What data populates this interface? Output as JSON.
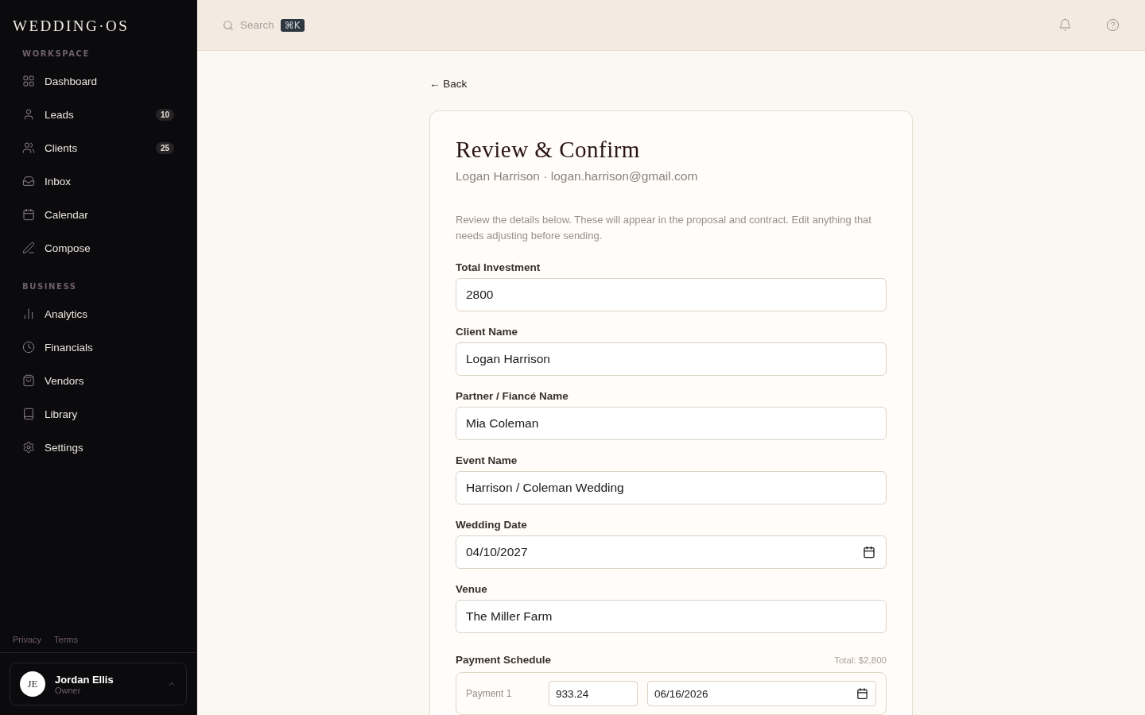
{
  "sidebar": {
    "logo": "WEDDING·OS",
    "sections": [
      {
        "title": "WORKSPACE",
        "items": [
          {
            "label": "Dashboard",
            "selected": false
          },
          {
            "label": "Leads",
            "badge": "10",
            "selected": false
          },
          {
            "label": "Clients",
            "badge": "25",
            "selected": false
          },
          {
            "label": "Inbox",
            "selected": false
          },
          {
            "label": "Calendar",
            "selected": false
          },
          {
            "label": "Compose",
            "selected": false
          }
        ]
      },
      {
        "title": "BUSINESS",
        "items": [
          {
            "label": "Analytics",
            "selected": false
          },
          {
            "label": "Financials",
            "selected": false
          },
          {
            "label": "Vendors",
            "selected": false
          },
          {
            "label": "Library",
            "selected": false
          },
          {
            "label": "Settings",
            "selected": false
          }
        ]
      }
    ],
    "footer_links": [
      "Privacy",
      "Terms"
    ],
    "user": {
      "initials": "JE",
      "name": "Jordan Ellis",
      "role": "Owner"
    }
  },
  "header": {
    "search_placeholder": "Search",
    "shortcut": "⌘K"
  },
  "back_link": "← Back",
  "card": {
    "title": "Review & Confirm",
    "subtitle": "Logan Harrison · logan.harrison@gmail.com",
    "intro": "Review the details below. These will appear in the proposal and contract. Edit anything that needs adjusting before sending.",
    "fields": [
      {
        "label": "Total Investment",
        "value": "2800",
        "kind": "text"
      },
      {
        "label": "Client Name",
        "value": "Logan Harrison",
        "kind": "text"
      },
      {
        "label": "Partner / Fiancé Name",
        "value": "Mia Coleman",
        "kind": "text"
      },
      {
        "label": "Event Name",
        "value": "Harrison / Coleman Wedding",
        "kind": "text"
      },
      {
        "label": "Wedding Date",
        "value": "04/10/2027",
        "kind": "date"
      },
      {
        "label": "Venue",
        "value": "The Miller Farm",
        "kind": "text"
      }
    ],
    "payment_schedule": {
      "label": "Payment Schedule",
      "total": "Total: $2,800",
      "payments": [
        {
          "label": "Payment 1",
          "amount": "933.24",
          "date": "06/16/2026"
        }
      ]
    }
  }
}
